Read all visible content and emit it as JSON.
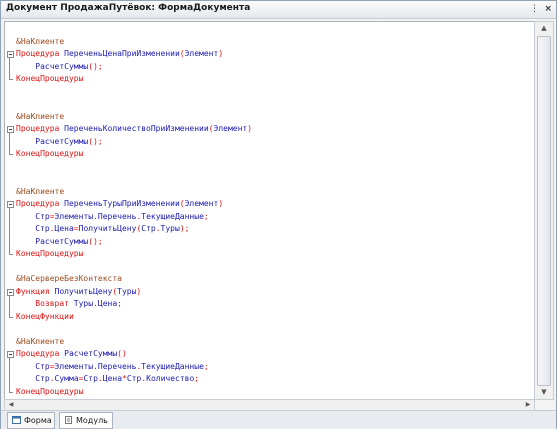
{
  "window": {
    "title": "Документ ПродажаПутёвок: ФормаДокумента",
    "dots_label": "⋮",
    "close_label": "×"
  },
  "editor": {
    "lines": [
      [],
      [
        {
          "t": "&НаКлиенте",
          "c": "dir"
        }
      ],
      [
        {
          "t": "Процедура ",
          "c": "kw"
        },
        {
          "t": "ПереченьЦенаПриИзменении",
          "c": "id"
        },
        {
          "t": "(",
          "c": "kw"
        },
        {
          "t": "Элемент",
          "c": "id"
        },
        {
          "t": ")",
          "c": "kw"
        }
      ],
      [
        {
          "t": "    РасчетСуммы",
          "c": "id"
        },
        {
          "t": "();",
          "c": "kw"
        }
      ],
      [
        {
          "t": "КонецПроцедуры",
          "c": "kw"
        }
      ],
      [],
      [],
      [
        {
          "t": "&НаКлиенте",
          "c": "dir"
        }
      ],
      [
        {
          "t": "Процедура ",
          "c": "kw"
        },
        {
          "t": "ПереченьКоличествоПриИзменении",
          "c": "id"
        },
        {
          "t": "(",
          "c": "kw"
        },
        {
          "t": "Элемент",
          "c": "id"
        },
        {
          "t": ")",
          "c": "kw"
        }
      ],
      [
        {
          "t": "    РасчетСуммы",
          "c": "id"
        },
        {
          "t": "();",
          "c": "kw"
        }
      ],
      [
        {
          "t": "КонецПроцедуры",
          "c": "kw"
        }
      ],
      [],
      [],
      [
        {
          "t": "&НаКлиенте",
          "c": "dir"
        }
      ],
      [
        {
          "t": "Процедура ",
          "c": "kw"
        },
        {
          "t": "ПереченьТурыПриИзменении",
          "c": "id"
        },
        {
          "t": "(",
          "c": "kw"
        },
        {
          "t": "Элемент",
          "c": "id"
        },
        {
          "t": ")",
          "c": "kw"
        }
      ],
      [
        {
          "t": "    Стр",
          "c": "id"
        },
        {
          "t": "=",
          "c": "kw"
        },
        {
          "t": "Элементы",
          "c": "id"
        },
        {
          "t": ".",
          "c": "kw"
        },
        {
          "t": "Перечень",
          "c": "id"
        },
        {
          "t": ".",
          "c": "kw"
        },
        {
          "t": "ТекущиеДанные",
          "c": "id"
        },
        {
          "t": ";",
          "c": "kw"
        }
      ],
      [
        {
          "t": "    Стр",
          "c": "id"
        },
        {
          "t": ".",
          "c": "kw"
        },
        {
          "t": "Цена",
          "c": "id"
        },
        {
          "t": "=",
          "c": "kw"
        },
        {
          "t": "ПолучитьЦену",
          "c": "id"
        },
        {
          "t": "(",
          "c": "kw"
        },
        {
          "t": "Стр",
          "c": "id"
        },
        {
          "t": ".",
          "c": "kw"
        },
        {
          "t": "Туры",
          "c": "id"
        },
        {
          "t": ");",
          "c": "kw"
        }
      ],
      [
        {
          "t": "    РасчетСуммы",
          "c": "id"
        },
        {
          "t": "();",
          "c": "kw"
        }
      ],
      [
        {
          "t": "КонецПроцедуры",
          "c": "kw"
        }
      ],
      [],
      [
        {
          "t": "&НаСервереБезКонтекста",
          "c": "dir"
        }
      ],
      [
        {
          "t": "Функция ",
          "c": "kw"
        },
        {
          "t": "ПолучитьЦену",
          "c": "id"
        },
        {
          "t": "(",
          "c": "kw"
        },
        {
          "t": "Туры",
          "c": "id"
        },
        {
          "t": ")",
          "c": "kw"
        }
      ],
      [
        {
          "t": "    Возврат ",
          "c": "kw"
        },
        {
          "t": "Туры",
          "c": "id"
        },
        {
          "t": ".",
          "c": "kw"
        },
        {
          "t": "Цена",
          "c": "id"
        },
        {
          "t": ";",
          "c": "kw"
        }
      ],
      [
        {
          "t": "КонецФункции",
          "c": "kw"
        }
      ],
      [],
      [
        {
          "t": "&НаКлиенте",
          "c": "dir"
        }
      ],
      [
        {
          "t": "Процедура ",
          "c": "kw"
        },
        {
          "t": "РасчетСуммы",
          "c": "id"
        },
        {
          "t": "()",
          "c": "kw"
        }
      ],
      [
        {
          "t": "    Стр",
          "c": "id"
        },
        {
          "t": "=",
          "c": "kw"
        },
        {
          "t": "Элементы",
          "c": "id"
        },
        {
          "t": ".",
          "c": "kw"
        },
        {
          "t": "Перечень",
          "c": "id"
        },
        {
          "t": ".",
          "c": "kw"
        },
        {
          "t": "ТекущиеДанные",
          "c": "id"
        },
        {
          "t": ";",
          "c": "kw"
        }
      ],
      [
        {
          "t": "    Стр",
          "c": "id"
        },
        {
          "t": ".",
          "c": "kw"
        },
        {
          "t": "Сумма",
          "c": "id"
        },
        {
          "t": "=",
          "c": "kw"
        },
        {
          "t": "Стр",
          "c": "id"
        },
        {
          "t": ".",
          "c": "kw"
        },
        {
          "t": "Цена",
          "c": "id"
        },
        {
          "t": "*",
          "c": "kw"
        },
        {
          "t": "Стр",
          "c": "id"
        },
        {
          "t": ".",
          "c": "kw"
        },
        {
          "t": "Количество",
          "c": "id"
        },
        {
          "t": ";",
          "c": "kw"
        }
      ],
      [
        {
          "t": "КонецПроцедуры",
          "c": "kw"
        }
      ]
    ],
    "folds": [
      [
        2,
        4
      ],
      [
        8,
        10
      ],
      [
        14,
        18
      ],
      [
        21,
        23
      ],
      [
        26,
        29
      ]
    ]
  },
  "scrollbars": {
    "up": "▲",
    "down": "▼",
    "left": "◀",
    "right": "▶"
  },
  "tabs": [
    {
      "label": "Форма",
      "icon": "form-icon",
      "active": false
    },
    {
      "label": "Модуль",
      "icon": "module-icon",
      "active": true
    }
  ]
}
